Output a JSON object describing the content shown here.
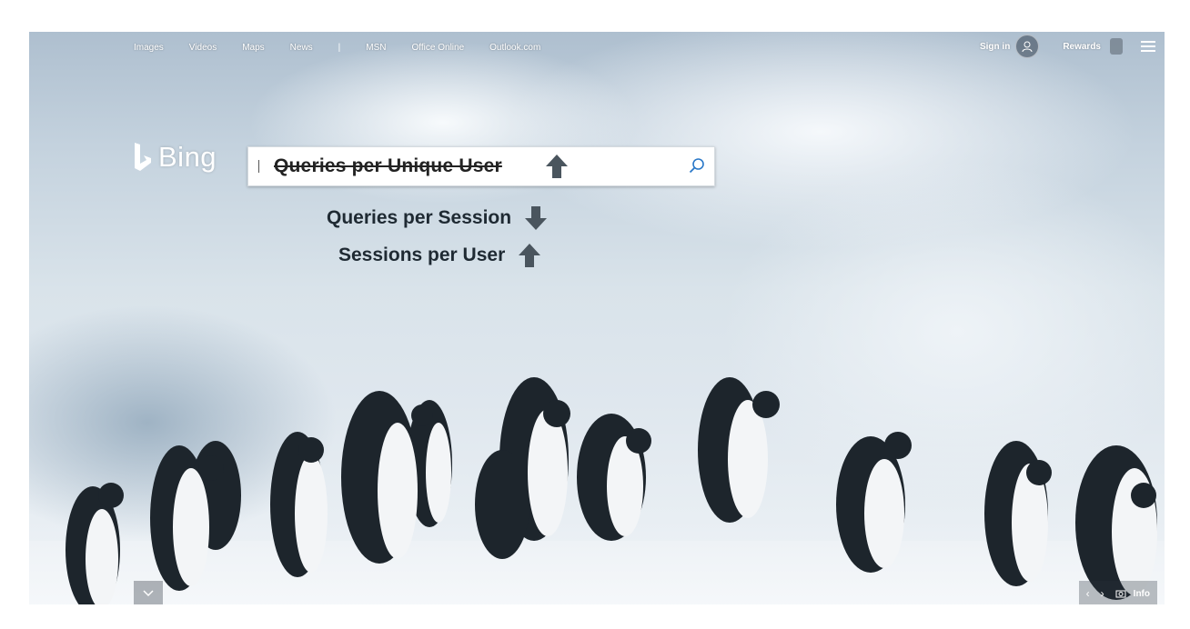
{
  "nav": {
    "links": [
      "Images",
      "Videos",
      "Maps",
      "News",
      "|",
      "MSN",
      "Office Online",
      "Outlook.com"
    ]
  },
  "account": {
    "signin": "Sign in",
    "rewards": "Rewards"
  },
  "logo": {
    "text": "Bing"
  },
  "search": {
    "query": "Queries per Unique User",
    "query_trend": "up"
  },
  "annotations": [
    {
      "text": "Queries per Session",
      "trend": "down"
    },
    {
      "text": "Sessions per User",
      "trend": "up"
    }
  ],
  "footer": {
    "info": "Info"
  },
  "colors": {
    "arrow": "#4a555e",
    "text_dark": "#1f2a33",
    "nav_text": "#ffffff"
  },
  "icons": [
    "bing-logo-icon",
    "search-icon",
    "menu-icon",
    "user-icon",
    "camera-icon",
    "chevron-down-icon",
    "chevron-left-icon",
    "chevron-right-icon"
  ]
}
